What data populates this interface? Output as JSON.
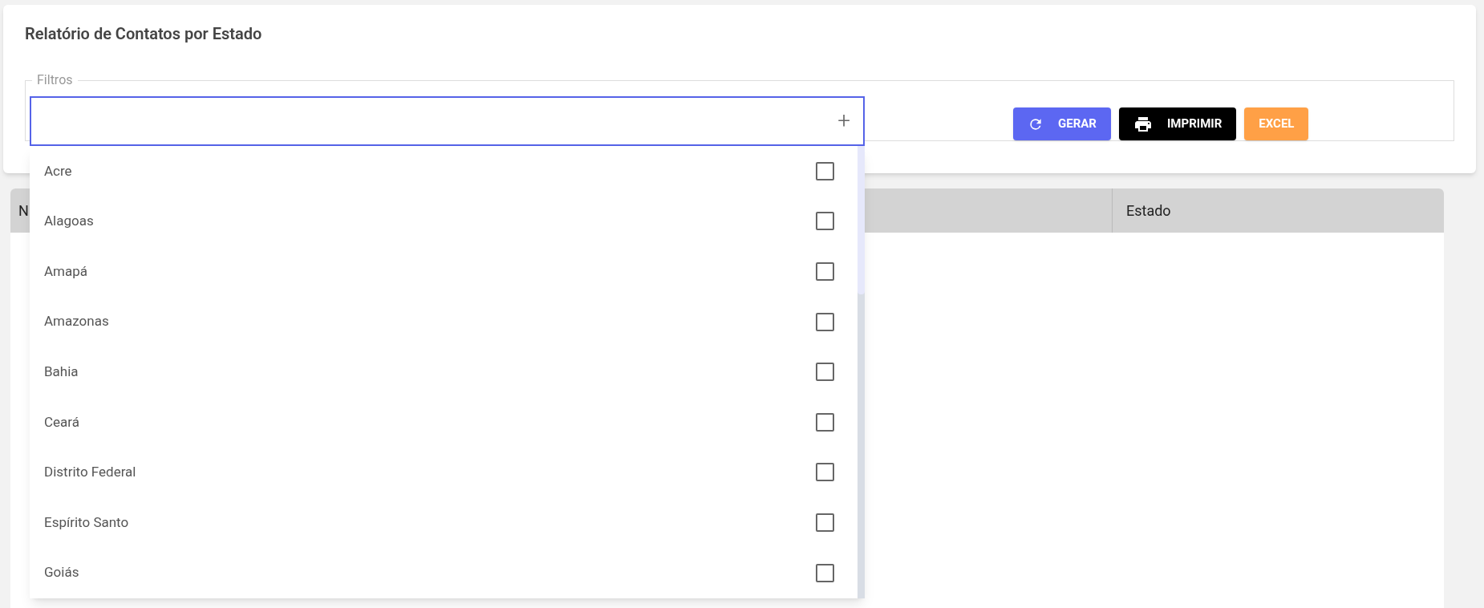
{
  "page_title": "Relatório de Contatos por Estado",
  "filters": {
    "legend": "Filtros",
    "add_symbol": "+",
    "options": [
      {
        "label": "Acre",
        "checked": false
      },
      {
        "label": "Alagoas",
        "checked": false
      },
      {
        "label": "Amapá",
        "checked": false
      },
      {
        "label": "Amazonas",
        "checked": false
      },
      {
        "label": "Bahia",
        "checked": false
      },
      {
        "label": "Ceará",
        "checked": false
      },
      {
        "label": "Distrito Federal",
        "checked": false
      },
      {
        "label": "Espírito Santo",
        "checked": false
      },
      {
        "label": "Goiás",
        "checked": false
      }
    ]
  },
  "buttons": [
    {
      "kind": "refresh",
      "label": "GERAR"
    },
    {
      "kind": "print",
      "label": "IMPRIMIR"
    },
    {
      "kind": "plain",
      "label": "EXCEL"
    }
  ],
  "table": {
    "columns": [
      "N",
      "Estado"
    ]
  }
}
